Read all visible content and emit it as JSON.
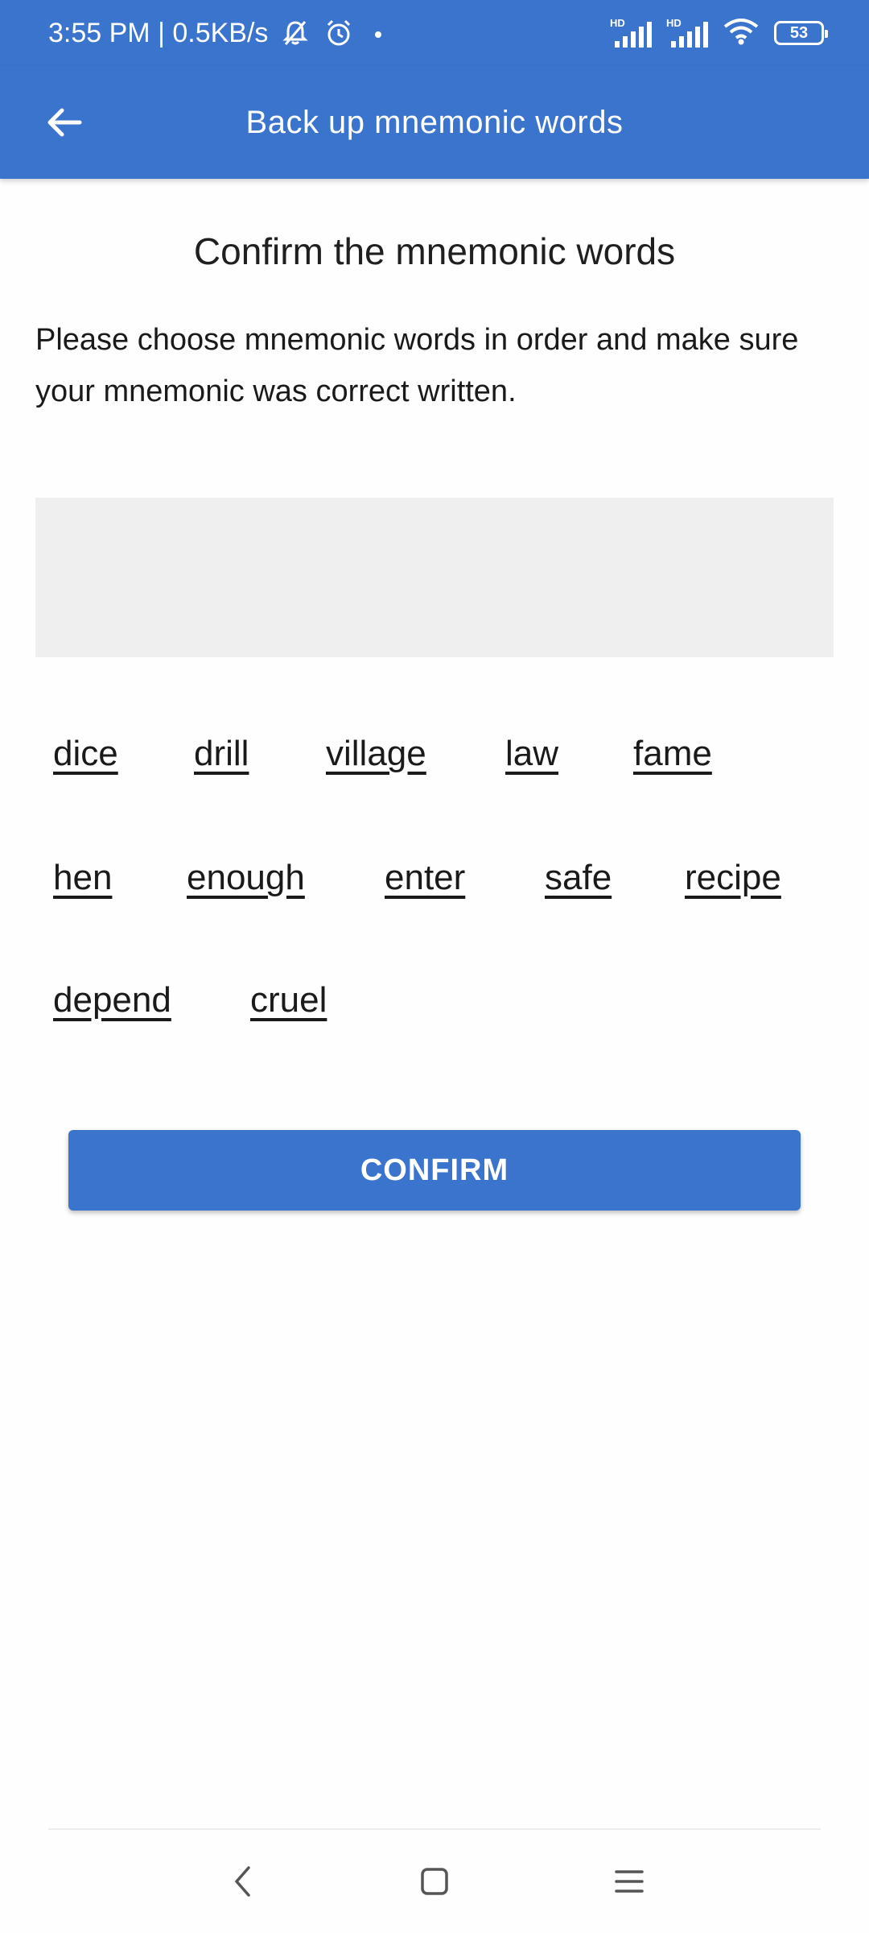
{
  "status_bar": {
    "time_speed": "3:55 PM | 0.5KB/s",
    "battery_level": "53"
  },
  "app_bar": {
    "title": "Back up mnemonic words"
  },
  "content": {
    "title": "Confirm the mnemonic words",
    "instructions": "Please choose mnemonic words in order and make sure your mnemonic was correct written."
  },
  "words": [
    "dice",
    "drill",
    "village",
    "law",
    "fame",
    "hen",
    "enough",
    "enter",
    "safe",
    "recipe",
    "depend",
    "cruel"
  ],
  "confirm_label": "CONFIRM",
  "colors": {
    "primary": "#3b74cc",
    "drop_area": "#efefef",
    "text": "#1a1a1a"
  }
}
